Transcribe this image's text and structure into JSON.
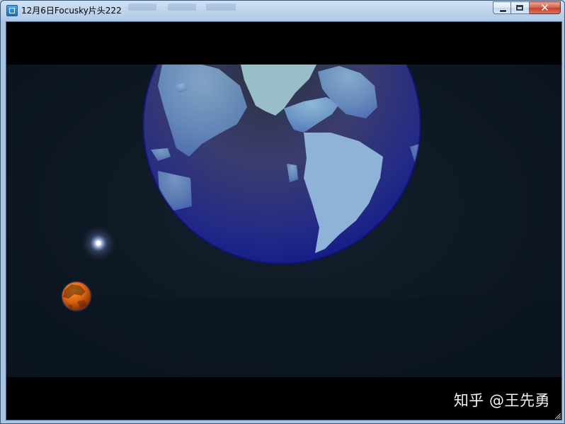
{
  "window": {
    "title": "12月6日Focusky片头222",
    "icon": "app-window-icon"
  },
  "caption_buttons": {
    "minimize_icon": "minimize-icon",
    "maximize_icon": "maximize-icon",
    "close_label": "✕"
  },
  "scene": {
    "planet_large": "earth-globe",
    "star": "glowing-star",
    "planet_small": "orange-planet"
  },
  "watermark": {
    "text": "知乎 @王先勇"
  },
  "colors": {
    "stage_background": "#0e1823",
    "ocean": "#3a3f7a",
    "land": "#5a86b8",
    "small_planet": "#d86a10"
  }
}
